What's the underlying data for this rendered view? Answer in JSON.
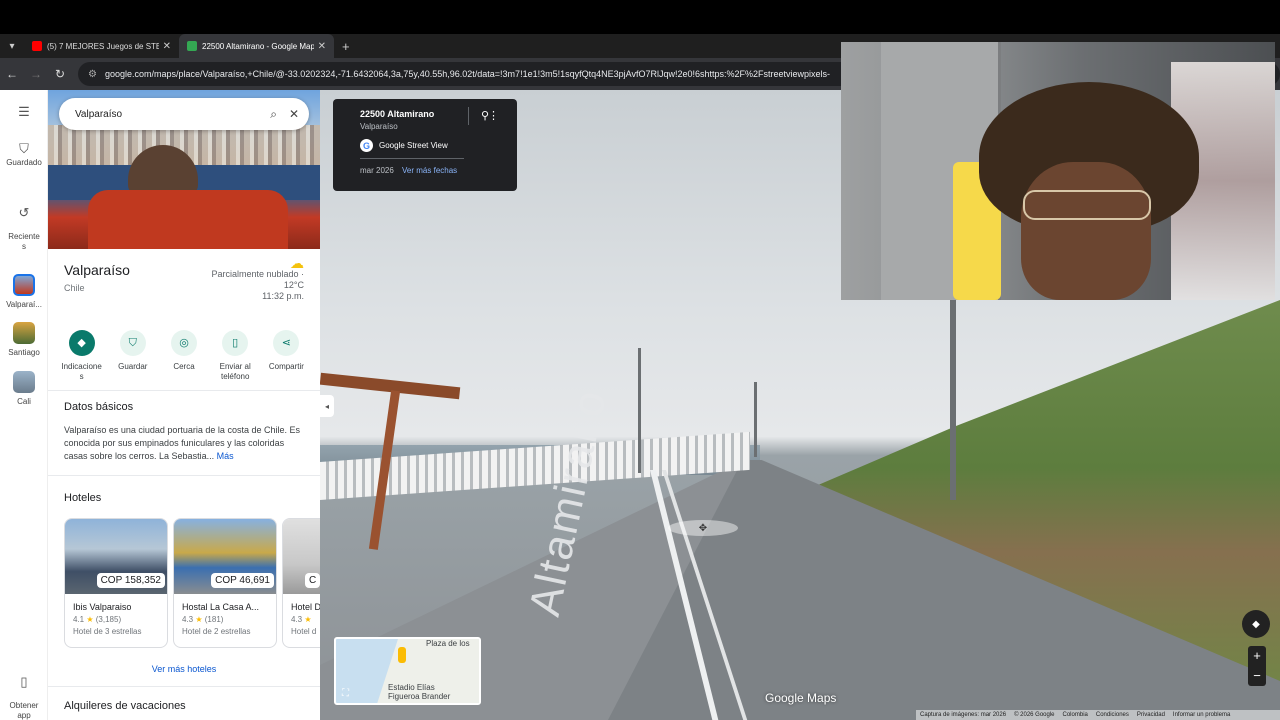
{
  "browser": {
    "tabs": [
      {
        "title": "(5) 7 MEJORES Juegos de STEAM",
        "favicon_color": "#ff0000",
        "active": false
      },
      {
        "title": "22500 Altamirano - Google Maps",
        "favicon_color": "#34a853",
        "active": true
      }
    ],
    "url": "google.com/maps/place/Valparaíso,+Chile/@-33.0202324,-71.6432064,3a,75y,40.55h,96.02t/data=!3m7!1e1!3m5!1sqyfQtq4NE3pjAvfO7RlJqw!2e0!6shttps:%2F%2Fstreetviewpixels-"
  },
  "rail": {
    "menu_icon": "hamburger-icon",
    "items": [
      {
        "label": "Guardado",
        "icon": "bookmark-icon"
      },
      {
        "label": "Reciente\ns",
        "icon": "history-icon"
      },
      {
        "label": "Valparaí...",
        "icon": "thumbnail"
      },
      {
        "label": "Santiago",
        "icon": "thumbnail"
      },
      {
        "label": "Cali",
        "icon": "thumbnail"
      },
      {
        "label": "Obtener\napp",
        "icon": "phone-icon"
      }
    ]
  },
  "search": {
    "value": "Valparaíso"
  },
  "place": {
    "name": "Valparaíso",
    "country": "Chile",
    "weather": {
      "condition": "Parcialmente nublado ·",
      "temp": "12°C",
      "time": "11:32 p.m."
    }
  },
  "actions": [
    {
      "label": "Indicacione\ns",
      "icon": "directions-icon"
    },
    {
      "label": "Guardar",
      "icon": "bookmark-icon"
    },
    {
      "label": "Cerca",
      "icon": "nearby-icon"
    },
    {
      "label": "Enviar al\nteléfono",
      "icon": "send-to-phone-icon"
    },
    {
      "label": "Compartir",
      "icon": "share-icon"
    }
  ],
  "basics": {
    "heading": "Datos básicos",
    "text": "Valparaíso es una ciudad portuaria de la costa de Chile. Es conocida por sus empinados funiculares y las coloridas casas sobre los cerros. La Sebastia...",
    "more": "Más"
  },
  "hotels": {
    "heading": "Hoteles",
    "items": [
      {
        "price": "COP 158,352",
        "name": "Ibis Valparaiso",
        "rating": "4.1",
        "reviews": "(3,185)",
        "class": "Hotel de 3 estrellas"
      },
      {
        "price": "COP 46,691",
        "name": "Hostal La Casa A...",
        "rating": "4.3",
        "reviews": "(181)",
        "class": "Hotel de 2 estrellas"
      },
      {
        "price": "C",
        "name": "Hotel D",
        "rating": "4.3",
        "reviews": "",
        "class": "Hotel d"
      }
    ],
    "more": "Ver más hoteles"
  },
  "rentals_heading": "Alquileres de vacaciones",
  "streetview": {
    "card": {
      "address": "22500 Altamirano",
      "city": "Valparaíso",
      "source": "Google Street View",
      "date": "mar 2026",
      "more_dates": "Ver más fechas"
    },
    "road_label": "Altamirano",
    "logo": "Google Maps",
    "minimap": {
      "label1": "Plaza de los",
      "label2": "Estadio Elías\nFigueroa Brander"
    },
    "attribution": [
      "Captura de imágenes: mar 2026",
      "© 2026 Google",
      "Colombia",
      "Condiciones",
      "Privacidad",
      "Informar un problema"
    ]
  }
}
